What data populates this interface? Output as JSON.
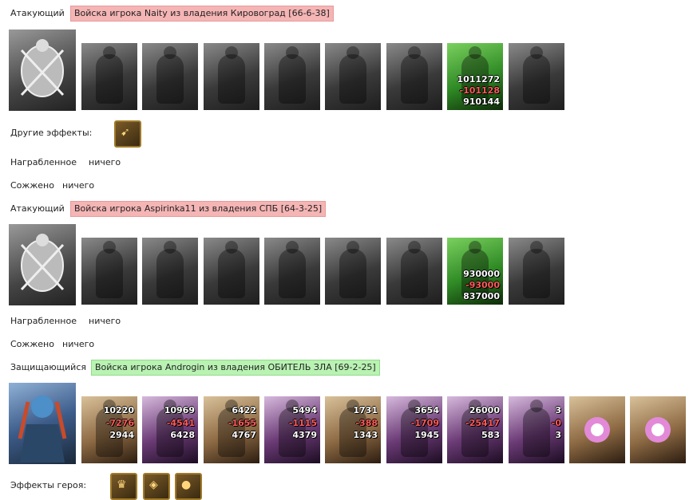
{
  "block1": {
    "role_label": "Атакующий",
    "banner": "Войска игрока Naity из владения Кировоград [66-6-38]",
    "stack_numbers": {
      "count": "1011272",
      "lost": "-101128",
      "left": "910144"
    },
    "other_effects_label": "Другие эффекты:",
    "plundered_label": "Награбленное",
    "plundered_value": "ничего",
    "burned_label": "Сожжено",
    "burned_value": "ничего"
  },
  "block2": {
    "role_label": "Атакующий",
    "banner": "Войска игрока Aspirinka11 из владения СПБ [64-3-25]",
    "stack_numbers": {
      "count": "930000",
      "lost": "-93000",
      "left": "837000"
    },
    "plundered_label": "Награбленное",
    "plundered_value": "ничего",
    "burned_label": "Сожжено",
    "burned_value": "ничего"
  },
  "block3": {
    "role_label": "Защищающийся",
    "banner": "Войска игрока Androgin из владения ОБИТЕЛЬ ЗЛА [69-2-25]",
    "stacks": [
      {
        "count": "10220",
        "lost": "-7276",
        "left": "2944"
      },
      {
        "count": "10969",
        "lost": "-4541",
        "left": "6428"
      },
      {
        "count": "6422",
        "lost": "-1655",
        "left": "4767"
      },
      {
        "count": "5494",
        "lost": "-1115",
        "left": "4379"
      },
      {
        "count": "1731",
        "lost": "-388",
        "left": "1343"
      },
      {
        "count": "3654",
        "lost": "-1709",
        "left": "1945"
      },
      {
        "count": "26000",
        "lost": "-25417",
        "left": "583"
      },
      {
        "count": "3",
        "lost": "-0",
        "left": "3"
      }
    ],
    "hero_effects_label": "Эффекты героя:"
  },
  "icons": {
    "crest": "crossed-bows-crest-icon",
    "effect": "boots-effect-icon",
    "hero_effects": [
      "winged-helmet-icon",
      "pendant-icon",
      "orb-icon"
    ]
  }
}
